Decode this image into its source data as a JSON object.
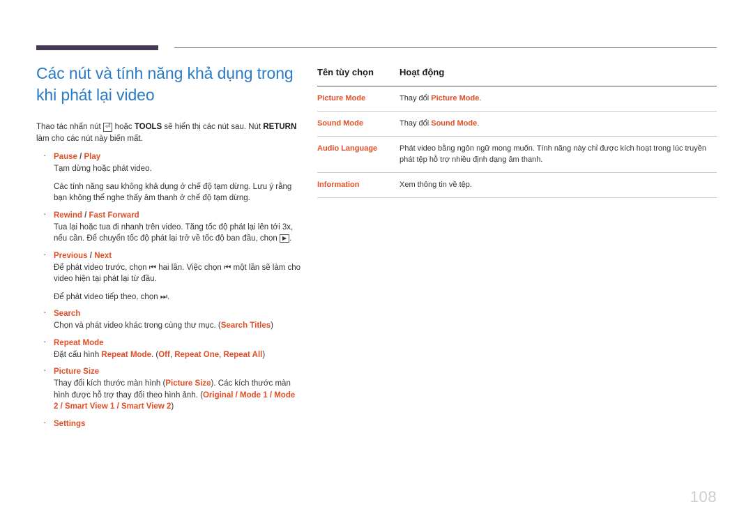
{
  "colors": {
    "title_blue": "#2a7ac4",
    "accent_orange": "#e04e26",
    "header_bar_dark": "#453a54",
    "rule_gray": "#6f6f6f",
    "page_number_gray": "#cdcdd3"
  },
  "header": {
    "dark_bar": "decorative-bar",
    "thin_rule": "decorative-rule"
  },
  "left": {
    "title": "Các nút và tính năng khả dụng trong khi phát lại video",
    "intro_1": "Thao tác nhấn nút",
    "intro_icon": "⏎",
    "intro_2": "hoặc",
    "intro_bold_tools": "TOOLS",
    "intro_3": "sẽ hiển thị các nút sau. Nút",
    "intro_bold_return": "RETURN",
    "intro_4": "làm cho các nút này biến mất.",
    "items": [
      {
        "title_a": "Pause",
        "sep": "/",
        "title_b": "Play",
        "paras": [
          "Tạm dừng hoặc phát video.",
          "Các tính năng sau không khả dụng ở chế độ tạm dừng. Lưu ý rằng bạn không thể nghe thấy âm thanh ở chế độ tạm dừng."
        ]
      },
      {
        "title_a": "Rewind",
        "sep": "/",
        "title_b": "Fast Forward",
        "paras": [
          "Tua lại hoặc tua đi nhanh trên video. Tăng tốc độ phát lại lên tới 3x, nếu cần. Để chuyển tốc độ phát lại trở về tốc độ ban đầu, chọn"
        ],
        "trail_icon": "▶",
        "trail_text": "."
      },
      {
        "title_a": "Previous",
        "sep": "/",
        "title_b": "Next",
        "paras": [
          "Để phát video trước, chọn ⏮ hai lần. Việc chọn ⏮ một lần sẽ làm cho video hiện tại phát lại từ đầu.",
          "Để phát video tiếp theo, chọn ⏭."
        ]
      },
      {
        "title_a": "Search",
        "sep": "",
        "title_b": "",
        "paras_rich": {
          "before": "Chọn và phát video khác trong cùng thư mục. (",
          "highlight": "Search Titles",
          "after": ")"
        }
      },
      {
        "title_a": "Repeat Mode",
        "sep": "",
        "title_b": "",
        "paras_rich": {
          "before": "Đặt cấu hình ",
          "highlight": "Repeat Mode",
          "mid": ". (",
          "opt1": "Off",
          "opt2": "Repeat One",
          "opt3": "Repeat All",
          "after": ")"
        }
      },
      {
        "title_a": "Picture Size",
        "sep": "",
        "title_b": "",
        "paras_rich": {
          "before": "Thay đổi kích thước màn hình (",
          "highlight": "Picture Size",
          "mid": "). Các kích thước màn hình được hỗ trợ thay đổi theo hình ảnh. (",
          "opt1": "Original",
          "opt2": "Mode 1",
          "opt3": "Mode 2",
          "opt4": "Smart View 1",
          "opt5": "Smart View 2",
          "after": ")"
        }
      },
      {
        "title_a": "Settings",
        "sep": "",
        "title_b": "",
        "paras": []
      }
    ]
  },
  "table": {
    "headers": [
      "Tên tùy chọn",
      "Hoạt động"
    ],
    "rows": [
      {
        "key": "Picture Mode",
        "desc_before": "Thay đổi ",
        "desc_hl": "Picture Mode",
        "desc_after": "."
      },
      {
        "key": "Sound Mode",
        "desc_before": "Thay đổi ",
        "desc_hl": "Sound Mode",
        "desc_after": "."
      },
      {
        "key": "Audio Language",
        "desc_before": "Phát video bằng ngôn ngữ mong muốn. Tính năng này chỉ được kích hoạt trong lúc truyền phát tệp hỗ trợ nhiều định dạng âm thanh.",
        "desc_hl": "",
        "desc_after": ""
      },
      {
        "key": "Information",
        "desc_before": "Xem thông tin về tệp.",
        "desc_hl": "",
        "desc_after": ""
      }
    ]
  },
  "footer": {
    "page_number": "108"
  }
}
